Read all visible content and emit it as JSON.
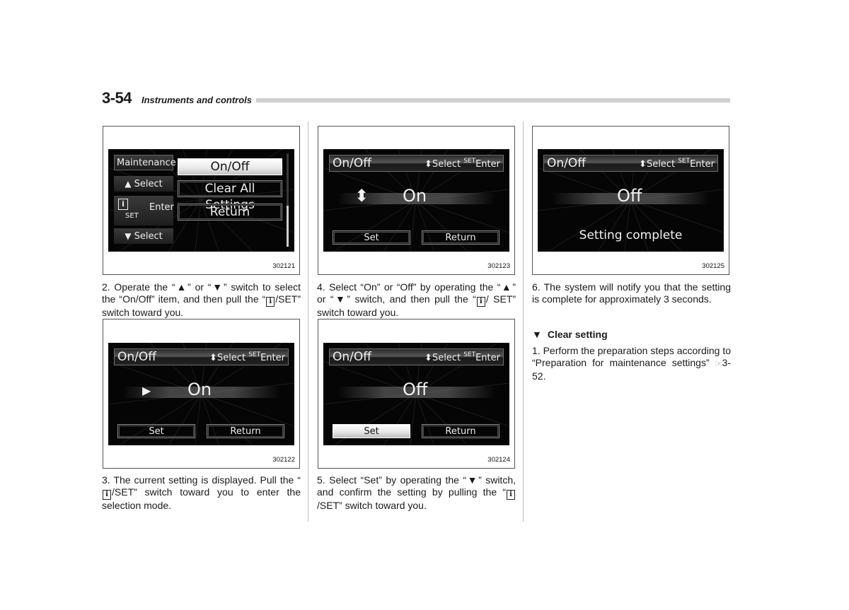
{
  "header": {
    "page_number": "3-54",
    "section_title": "Instruments and controls"
  },
  "lcd_common": {
    "title": "On/Off",
    "hint_select": "Select",
    "hint_set": "SET",
    "hint_enter": "Enter",
    "set_button": "Set",
    "return_button": "Return"
  },
  "figures": [
    {
      "code": "302121",
      "menu_left": [
        "Maintenance",
        "Select",
        "Enter",
        "Select"
      ],
      "menu_left_set_label": "SET",
      "menu_items": [
        "On/Off",
        "Clear All Settings",
        "Return"
      ],
      "selected_item": "On/Off"
    },
    {
      "code": "302122",
      "value": "On",
      "indicator": "play-arrow",
      "selected_button": "none"
    },
    {
      "code": "302123",
      "value": "On",
      "indicator": "up-down-arrows",
      "selected_button": "none"
    },
    {
      "code": "302124",
      "value": "Off",
      "indicator": "none",
      "selected_button": "Set"
    },
    {
      "code": "302125",
      "value": "Off",
      "message": "Setting complete"
    }
  ],
  "steps": {
    "s2": {
      "a": "2. Operate the “",
      "b": "” or “",
      "c": "” switch to select the “On/Off” item, and then pull the “",
      "d": "/SET” switch toward you."
    },
    "s3": {
      "a": "3. The current setting is displayed. Pull the “",
      "b": "/SET” switch toward you to enter the selection mode."
    },
    "s4": {
      "a": "4. Select “On” or “Off” by operating the “",
      "b": "” or “",
      "c": "” switch, and then pull the “",
      "d": "/ SET” switch toward you."
    },
    "s5": {
      "a": "5. Select “Set” by operating the “",
      "b": "” switch, and confirm the setting by pulling the “",
      "c": "/SET” switch toward you."
    },
    "s6": "6. The system will notify you that the setting is complete for approximately 3 seconds.",
    "clear_heading": "Clear setting",
    "c1_a": "1. Perform the preparation steps according to “Preparation for maintenance settings” ",
    "c1_ref": "3-52."
  },
  "glyphs": {
    "up": "▲",
    "down": "▼",
    "info": "i",
    "ref": "☞",
    "play": "▶",
    "updown": "⬍"
  }
}
